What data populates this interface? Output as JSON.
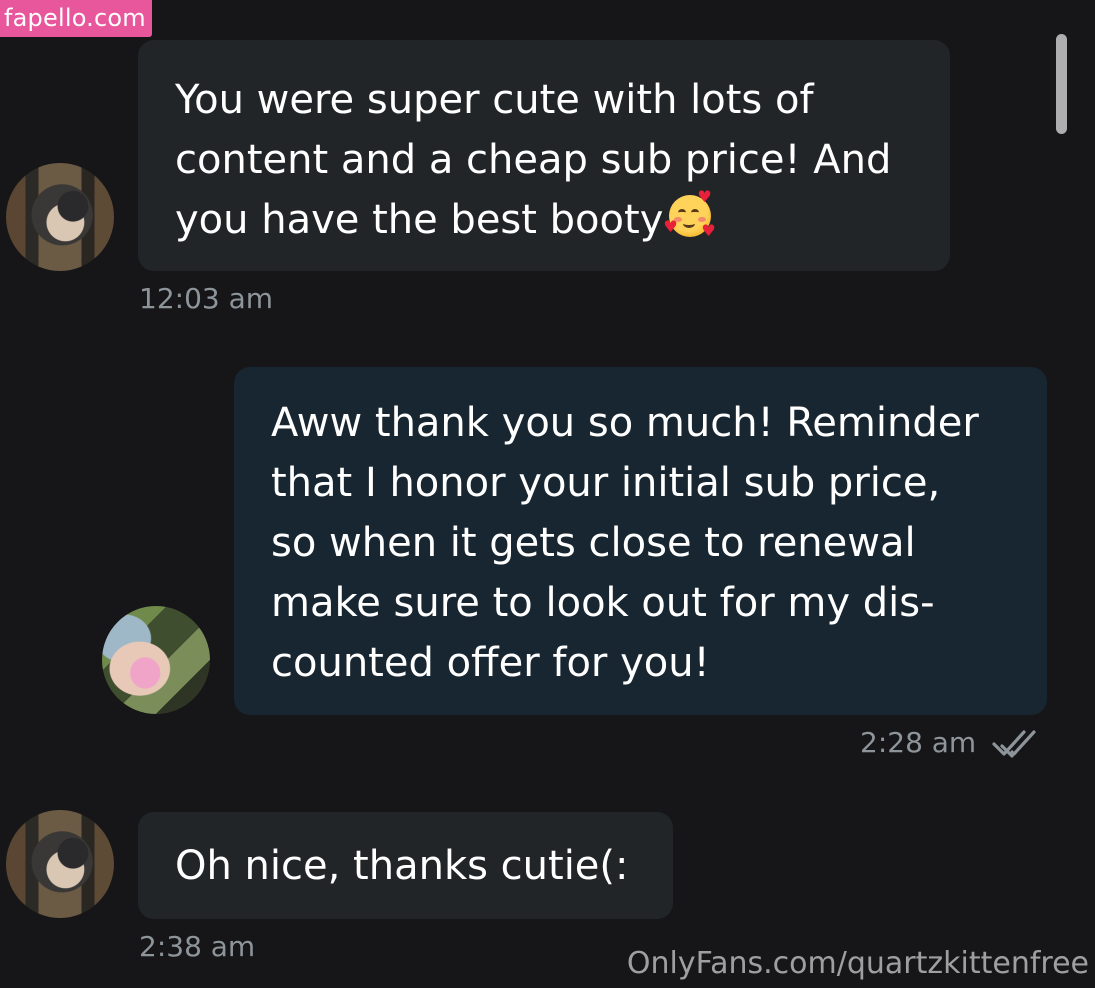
{
  "watermark": {
    "top": "fapello.com",
    "bottom": "OnlyFans.com/quartzkittenfree"
  },
  "messages": [
    {
      "side": "incoming",
      "text": "You were super cute with lots of\ncontent and a cheap sub price! And\nyou have the best booty",
      "emoji": "smiling-face-with-hearts-icon",
      "time": "12:03 am"
    },
    {
      "side": "outgoing",
      "text": "Aww thank you so much! Reminder\nthat I honor your initial sub price,\nso when it gets close to renewal\nmake sure to look out for my dis-\ncounted offer for you!",
      "time": "2:28 am",
      "status_icon": "double-check-icon"
    },
    {
      "side": "incoming",
      "text": "Oh nice, thanks cutie(:",
      "time": "2:38 am"
    }
  ],
  "colors": {
    "background": "#161618",
    "incoming_bubble": "#222527",
    "outgoing_bubble": "#172630",
    "timestamp": "#8d949a",
    "watermark_badge": "#e8579b"
  }
}
